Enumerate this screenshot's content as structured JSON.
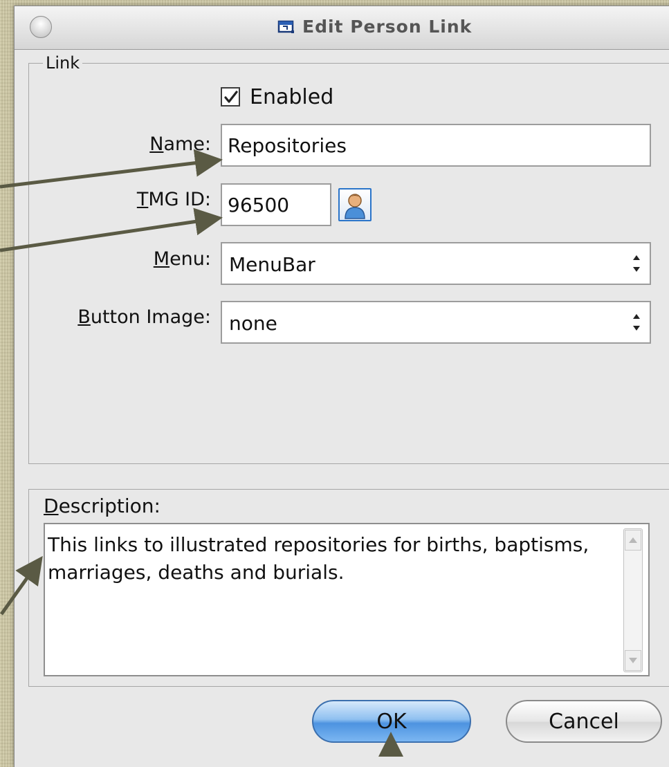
{
  "window": {
    "title": "Edit Person Link",
    "title_icon": "flag-window-icon"
  },
  "link_group": {
    "legend": "Link",
    "enabled": {
      "label": "Enabled",
      "checked": true
    },
    "name": {
      "label_mnemonic": "N",
      "label_rest": "ame:",
      "value": "Repositories"
    },
    "tmg_id": {
      "label_mnemonic": "T",
      "label_rest": "MG ID:",
      "value": "96500",
      "person_button_icon": "person-icon"
    },
    "menu": {
      "label_mnemonic": "M",
      "label_rest": "enu:",
      "selected": "MenuBar"
    },
    "button_image": {
      "label_mnemonic": "B",
      "label_rest": "utton Image:",
      "selected": "none"
    }
  },
  "description": {
    "label_mnemonic": "D",
    "label_rest": "escription:",
    "text": "This links to illustrated repositories for births, baptisms, marriages, deaths and burials."
  },
  "buttons": {
    "ok": "OK",
    "cancel": "Cancel"
  },
  "colors": {
    "background": "#cdc7a3",
    "window": "#e8e8e8",
    "ok_accent": "#4d93e0",
    "annotation_arrow": "#5a5a44"
  }
}
